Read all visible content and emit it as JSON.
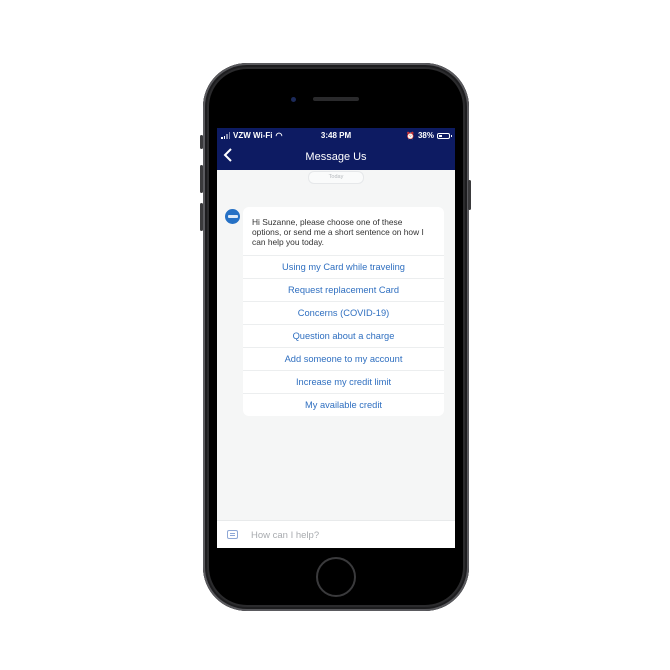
{
  "status_bar": {
    "carrier": "VZW Wi-Fi",
    "time": "3:48 PM",
    "battery_percent_label": "38%",
    "battery_level": 0.38
  },
  "nav": {
    "back_label": "‹",
    "title": "Message Us"
  },
  "chat": {
    "date_divider": "Today",
    "bot_message": "Hi Suzanne, please choose one of these options, or send me a short sentence on how I can help you today.",
    "options": [
      "Using my Card while traveling",
      "Request replacement Card",
      "Concerns (COVID-19)",
      "Question about a charge",
      "Add someone to my account",
      "Increase my credit limit",
      "My available credit"
    ]
  },
  "composer": {
    "placeholder": "How can I help?",
    "value": ""
  },
  "colors": {
    "header": "#0d1b62",
    "link": "#2f6fc0",
    "avatar": "#2671c5"
  }
}
